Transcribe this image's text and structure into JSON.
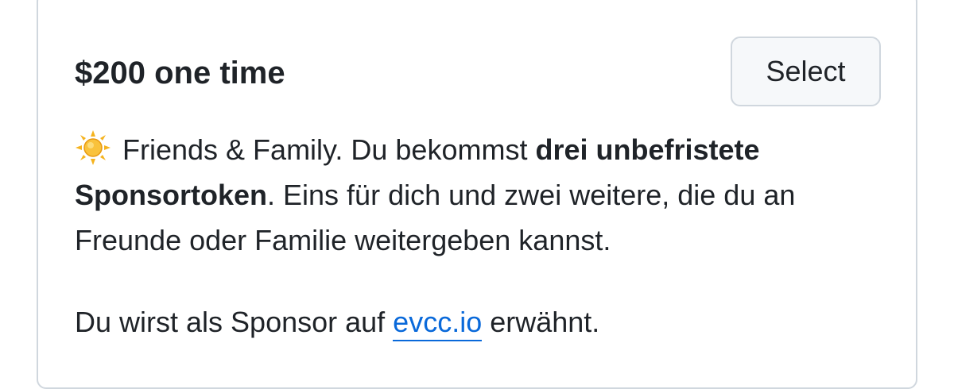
{
  "tier": {
    "title": "$200 one time",
    "select_label": "Select"
  },
  "description": {
    "icon": "sun-emoji-icon",
    "intro": "Friends & Family. Du bekommst ",
    "bold_1": "drei unbefristete Sponsortoken",
    "rest": ". Eins für dich und zwei weitere, die du an Freunde oder Familie weitergeben kannst."
  },
  "mention": {
    "before": "Du wirst als Sponsor auf ",
    "link_text": "evcc.io",
    "after": " erwähnt."
  },
  "colors": {
    "link": "#0969da",
    "border": "#d0d7de",
    "button_bg": "#f6f8fa",
    "text": "#1f2328"
  }
}
